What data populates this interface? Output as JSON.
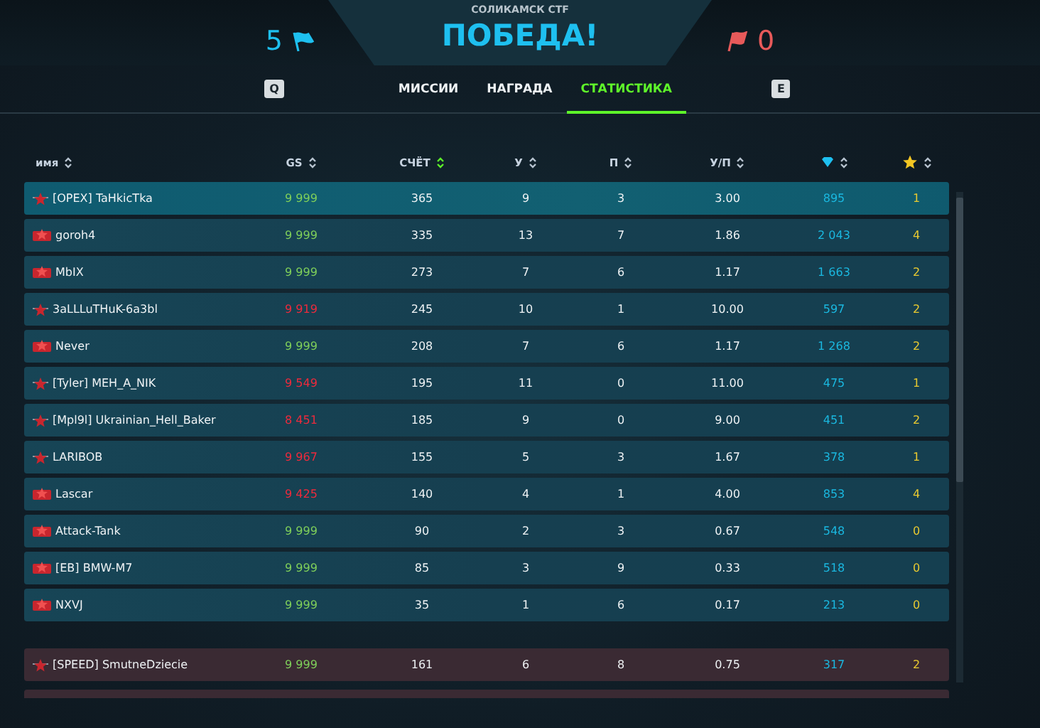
{
  "header": {
    "map": "СОЛИКАМСК CTF",
    "result": "ПОБЕДА!",
    "ally_score": "5",
    "enemy_score": "0"
  },
  "tabs": {
    "prev_key": "Q",
    "next_key": "E",
    "items": [
      {
        "label": "МИССИИ",
        "selected": false
      },
      {
        "label": "НАГРАДА",
        "selected": false
      },
      {
        "label": "СТАТИСТИКА",
        "selected": true
      }
    ]
  },
  "table": {
    "columns": [
      {
        "kind": "text",
        "label": "имя",
        "sorted": false
      },
      {
        "kind": "text",
        "label": "GS",
        "sorted": false
      },
      {
        "kind": "text",
        "label": "СЧЁТ",
        "sorted": true
      },
      {
        "kind": "text",
        "label": "У",
        "sorted": false
      },
      {
        "kind": "text",
        "label": "П",
        "sorted": false
      },
      {
        "kind": "text",
        "label": "У/П",
        "sorted": false
      },
      {
        "kind": "crystal",
        "sorted": false
      },
      {
        "kind": "star",
        "sorted": false
      }
    ],
    "teams": [
      {
        "kind": "ally",
        "rows": [
          {
            "kind": "star",
            "name": "[OPEX] TaHkicTka",
            "gs": "9 999",
            "gs_low": false,
            "score": "365",
            "kills": "9",
            "deaths": "3",
            "ratio": "3.00",
            "crystals": "895",
            "star_count": "1",
            "selected": true
          },
          {
            "kind": "badge",
            "name": "goroh4",
            "gs": "9 999",
            "gs_low": false,
            "score": "335",
            "kills": "13",
            "deaths": "7",
            "ratio": "1.86",
            "crystals": "2 043",
            "star_count": "4",
            "selected": false
          },
          {
            "kind": "badge",
            "name": "MbIX",
            "gs": "9 999",
            "gs_low": false,
            "score": "273",
            "kills": "7",
            "deaths": "6",
            "ratio": "1.17",
            "crystals": "1 663",
            "star_count": "2",
            "selected": false
          },
          {
            "kind": "star",
            "name": "3aLLLuTHuK-6a3bl",
            "gs": "9 919",
            "gs_low": true,
            "score": "245",
            "kills": "10",
            "deaths": "1",
            "ratio": "10.00",
            "crystals": "597",
            "star_count": "2",
            "selected": false
          },
          {
            "kind": "badge",
            "name": "Never",
            "gs": "9 999",
            "gs_low": false,
            "score": "208",
            "kills": "7",
            "deaths": "6",
            "ratio": "1.17",
            "crystals": "1 268",
            "star_count": "2",
            "selected": false
          },
          {
            "kind": "star",
            "name": "[Tyler] MEH_A_NIK",
            "gs": "9 549",
            "gs_low": true,
            "score": "195",
            "kills": "11",
            "deaths": "0",
            "ratio": "11.00",
            "crystals": "475",
            "star_count": "1",
            "selected": false
          },
          {
            "kind": "star",
            "name": "[Mpl9l] Ukrainian_Hell_Baker",
            "gs": "8 451",
            "gs_low": true,
            "score": "185",
            "kills": "9",
            "deaths": "0",
            "ratio": "9.00",
            "crystals": "451",
            "star_count": "2",
            "selected": false
          },
          {
            "kind": "star",
            "name": "LARIBOB",
            "gs": "9 967",
            "gs_low": true,
            "score": "155",
            "kills": "5",
            "deaths": "3",
            "ratio": "1.67",
            "crystals": "378",
            "star_count": "1",
            "selected": false
          },
          {
            "kind": "badge",
            "name": "Lascar",
            "gs": "9 425",
            "gs_low": true,
            "score": "140",
            "kills": "4",
            "deaths": "1",
            "ratio": "4.00",
            "crystals": "853",
            "star_count": "4",
            "selected": false
          },
          {
            "kind": "badge",
            "name": "Attack-Tank",
            "gs": "9 999",
            "gs_low": false,
            "score": "90",
            "kills": "2",
            "deaths": "3",
            "ratio": "0.67",
            "crystals": "548",
            "star_count": "0",
            "selected": false
          },
          {
            "kind": "badge",
            "name": "[EB] BMW-M7",
            "gs": "9 999",
            "gs_low": false,
            "score": "85",
            "kills": "3",
            "deaths": "9",
            "ratio": "0.33",
            "crystals": "518",
            "star_count": "0",
            "selected": false
          },
          {
            "kind": "badge",
            "name": "NXVJ",
            "gs": "9 999",
            "gs_low": false,
            "score": "35",
            "kills": "1",
            "deaths": "6",
            "ratio": "0.17",
            "crystals": "213",
            "star_count": "0",
            "selected": false
          }
        ]
      },
      {
        "kind": "enemy",
        "rows": [
          {
            "kind": "star",
            "name": "[SPEED] SmutneDziecie",
            "gs": "9 999",
            "gs_low": false,
            "score": "161",
            "kills": "6",
            "deaths": "8",
            "ratio": "0.75",
            "crystals": "317",
            "star_count": "2",
            "selected": false
          }
        ]
      }
    ]
  }
}
